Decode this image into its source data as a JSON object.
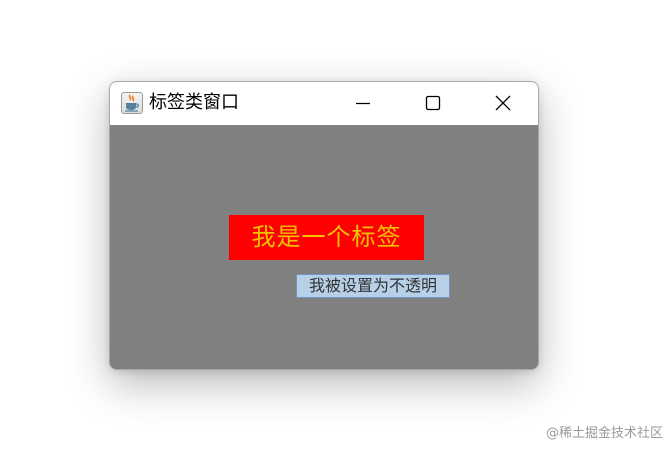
{
  "window": {
    "title": "标签类窗口",
    "app_icon": "java-coffee-icon",
    "controls": {
      "minimize_icon": "minimize-icon",
      "maximize_icon": "maximize-icon",
      "close_icon": "close-icon"
    }
  },
  "content": {
    "background_color": "#808080",
    "red_label": {
      "text": "我是一个标签",
      "background_color": "#ff0000",
      "text_color": "#f2c200"
    },
    "opaque_label": {
      "text": "我被设置为不透明",
      "background_color": "#b8cfe8",
      "text_color": "#333333"
    }
  },
  "watermark": {
    "text": "@稀土掘金技术社区"
  }
}
